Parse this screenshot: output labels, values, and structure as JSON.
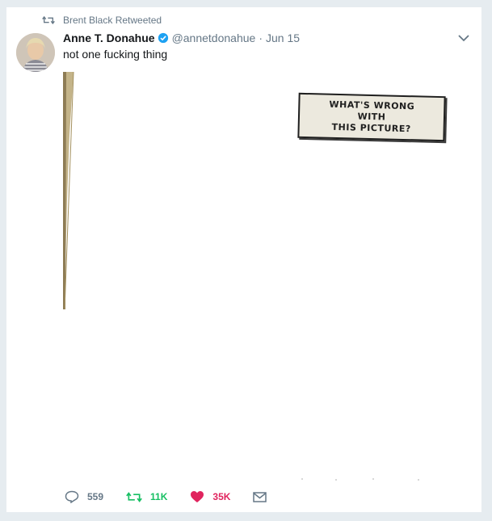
{
  "context": {
    "retweeted_by": "Brent Black Retweeted"
  },
  "tweet": {
    "author_name": "Anne T. Donahue",
    "handle": "@annetdonahue",
    "separator": "·",
    "date": "Jun 15",
    "text": "not one fucking thing",
    "media": {
      "sign_lines": [
        "WHAT'S WRONG",
        "WITH",
        "THIS PICTURE?"
      ]
    }
  },
  "actions": {
    "reply_count": "559",
    "retweet_count": "11K",
    "like_count": "35K"
  },
  "colors": {
    "retweet": "#17bf63",
    "like": "#e0245e",
    "verified": "#1da1f2",
    "muted": "#657786"
  }
}
